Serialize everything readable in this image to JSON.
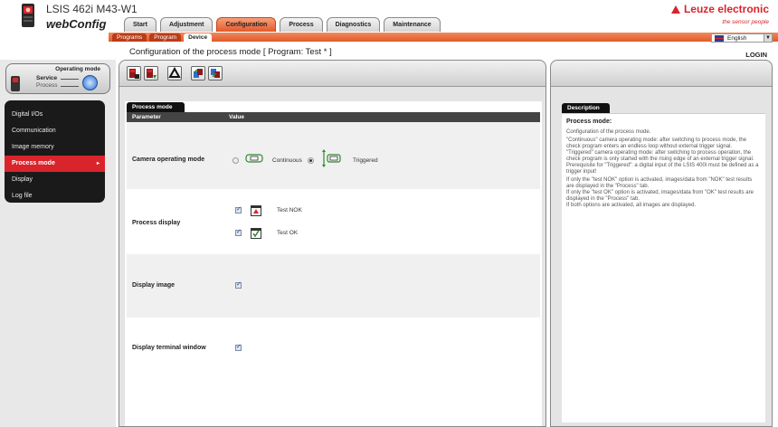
{
  "header": {
    "app_name": "LSIS 462i M43-W1",
    "app_subtitle": "webConfig",
    "brand": "Leuze electronic",
    "tagline": "the sensor people"
  },
  "main_tabs": [
    {
      "label": "Start",
      "active": false
    },
    {
      "label": "Adjustment",
      "active": false
    },
    {
      "label": "Configuration",
      "active": true
    },
    {
      "label": "Process",
      "active": false
    },
    {
      "label": "Diagnostics",
      "active": false
    },
    {
      "label": "Maintenance",
      "active": false
    }
  ],
  "sub_tabs": [
    {
      "label": "Programs",
      "active": false
    },
    {
      "label": "Program",
      "active": false
    },
    {
      "label": "Device",
      "active": true
    }
  ],
  "language": {
    "selected": "English"
  },
  "page": {
    "title": "Configuration of the process mode   [ Program: Test * ]",
    "login_label": "LOGIN"
  },
  "operating_mode": {
    "title": "Operating mode",
    "service_label": "Service",
    "process_label": "Process"
  },
  "left_nav": {
    "items": [
      {
        "label": "Digital I/Os",
        "active": false
      },
      {
        "label": "Communication",
        "active": false
      },
      {
        "label": "Image memory",
        "active": false
      },
      {
        "label": "Process mode",
        "active": true
      },
      {
        "label": "Display",
        "active": false
      },
      {
        "label": "Log file",
        "active": false
      }
    ]
  },
  "toolbar": {
    "icons": [
      "camera-save-icon",
      "camera-load-icon",
      "recycle-icon",
      "transfer-up-icon",
      "transfer-down-icon"
    ]
  },
  "process_mode": {
    "tab_label": "Process mode",
    "col_parameter": "Parameter",
    "col_value": "Value",
    "camera_mode": {
      "label": "Camera operating mode",
      "continuous_label": "Continuous",
      "triggered_label": "Triggered",
      "selected": "Triggered"
    },
    "process_display": {
      "label": "Process display",
      "nok_label": "Test NOK",
      "nok_checked": true,
      "ok_label": "Test OK",
      "ok_checked": true
    },
    "display_image": {
      "label": "Display image",
      "checked": true
    },
    "display_terminal": {
      "label": "Display terminal window",
      "checked": true
    }
  },
  "description": {
    "tab_label": "Description",
    "heading": "Process mode:",
    "p1": "Configuration of the process mode.",
    "p2": "\"Continuous\" camera operating mode: after switching to process mode, the check program enters an endless loop without external trigger signal.",
    "p3": "\"Triggered\" camera operating mode: after switching to process operation, the check program is only started with the rising edge of an external trigger signal.",
    "p4": "Prerequisite for \"Triggered\": a digital input of the LSIS 400i must be defined as a trigger input!",
    "p5": "If only the \"test NOK\" option is activated, images/data from \"NOK\" test results are displayed in the \"Process\" tab.",
    "p6": "If only the \"test OK\" option is activated, images/data from \"OK\" test results are displayed in the \"Process\" tab.",
    "p7": "If both options are activated, all images are displayed."
  }
}
